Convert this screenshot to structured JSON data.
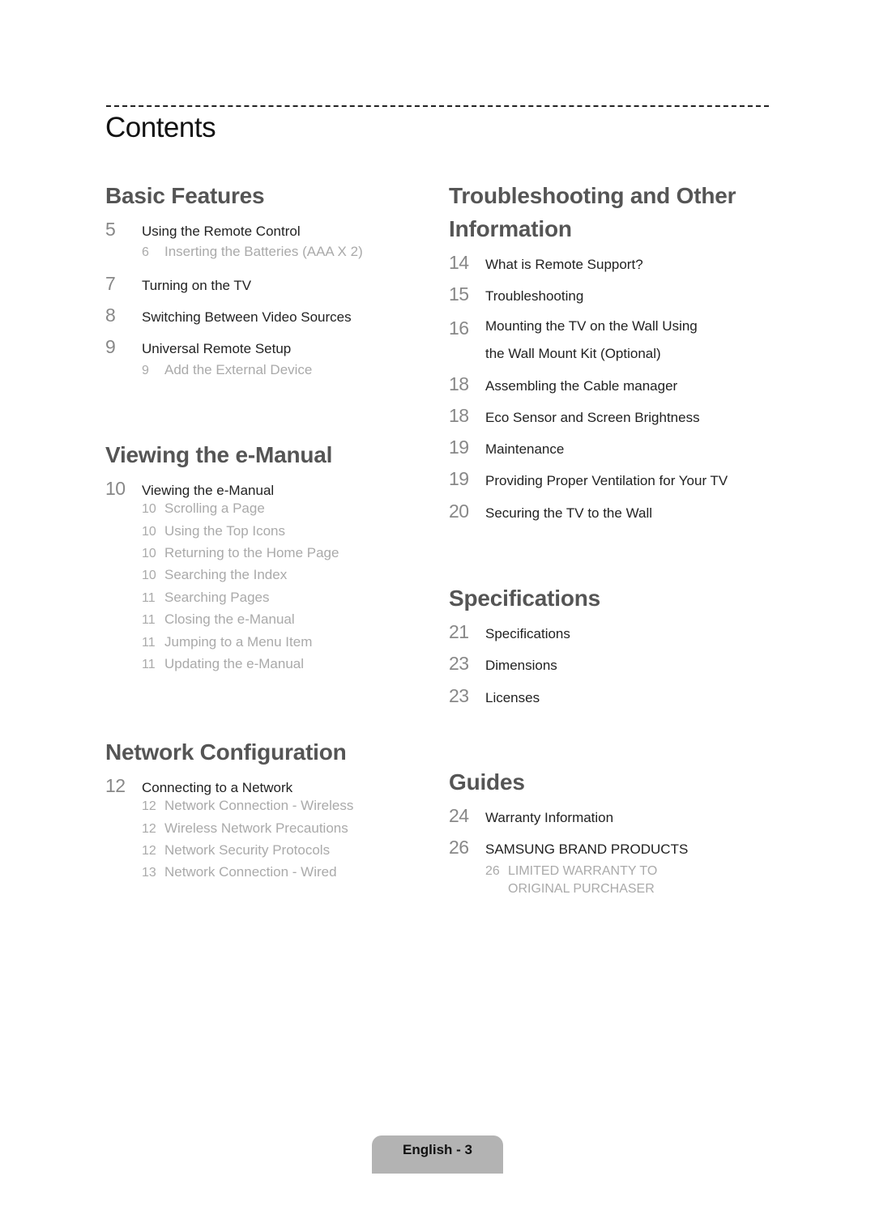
{
  "page": {
    "title": "Contents",
    "footer_label": "English - 3"
  },
  "sections": {
    "basic_features": {
      "title": "Basic Features",
      "entries": [
        {
          "page": "5",
          "label": "Using the Remote Control",
          "subs": [
            {
              "page": "6",
              "label": "Inserting the Batteries (AAA X 2)"
            }
          ]
        },
        {
          "page": "7",
          "label": "Turning on the TV"
        },
        {
          "page": "8",
          "label": "Switching Between Video Sources"
        },
        {
          "page": "9",
          "label": "Universal Remote Setup",
          "subs": [
            {
              "page": "9",
              "label": "Add the External Device"
            }
          ]
        }
      ]
    },
    "viewing_emanual": {
      "title": "Viewing the e-Manual",
      "entries": [
        {
          "page": "10",
          "label": "Viewing the e-Manual",
          "subs": [
            {
              "page": "10",
              "label": "Scrolling a Page"
            },
            {
              "page": "10",
              "label": "Using the Top Icons"
            },
            {
              "page": "10",
              "label": "Returning to the Home Page"
            },
            {
              "page": "10",
              "label": "Searching the Index"
            },
            {
              "page": "11",
              "label": "Searching Pages"
            },
            {
              "page": "11",
              "label": "Closing the e-Manual"
            },
            {
              "page": "11",
              "label": "Jumping to a Menu Item"
            },
            {
              "page": "11",
              "label": "Updating the e-Manual"
            }
          ]
        }
      ]
    },
    "network_configuration": {
      "title": "Network Configuration",
      "entries": [
        {
          "page": "12",
          "label": "Connecting to a Network",
          "subs": [
            {
              "page": "12",
              "label": "Network Connection - Wireless"
            },
            {
              "page": "12",
              "label": "Wireless Network Precautions"
            },
            {
              "page": "12",
              "label": "Network Security Protocols"
            },
            {
              "page": "13",
              "label": "Network Connection - Wired"
            }
          ]
        }
      ]
    },
    "troubleshooting": {
      "title_line1": "Troubleshooting and Other",
      "title_line2": "Information",
      "entries": [
        {
          "page": "14",
          "label": "What is Remote Support?"
        },
        {
          "page": "15",
          "label": "Troubleshooting"
        },
        {
          "page": "16",
          "label_line1": "Mounting the TV on the Wall Using",
          "label_line2": "the Wall Mount Kit (Optional)"
        },
        {
          "page": "18",
          "label": "Assembling the Cable manager"
        },
        {
          "page": "18",
          "label": "Eco Sensor and Screen Brightness"
        },
        {
          "page": "19",
          "label": "Maintenance"
        },
        {
          "page": "19",
          "label": "Providing Proper Ventilation for Your TV"
        },
        {
          "page": "20",
          "label": "Securing the TV to the Wall"
        }
      ]
    },
    "specifications": {
      "title": "Specifications",
      "entries": [
        {
          "page": "21",
          "label": "Specifications"
        },
        {
          "page": "23",
          "label": "Dimensions"
        },
        {
          "page": "23",
          "label": "Licenses"
        }
      ]
    },
    "guides": {
      "title": "Guides",
      "entries": [
        {
          "page": "24",
          "label": "Warranty Information"
        },
        {
          "page": "26",
          "label": "SAMSUNG BRAND PRODUCTS",
          "subs": [
            {
              "page": "26",
              "label_line1": "LIMITED WARRANTY TO",
              "label_line2": "ORIGINAL PURCHASER"
            }
          ]
        }
      ]
    }
  },
  "colors": {
    "section_title": "#555555",
    "entry_text": "#222222",
    "page_number": "#888888",
    "sub_entry": "#aaaaaa",
    "footer_tab": "#b3b3b3"
  }
}
